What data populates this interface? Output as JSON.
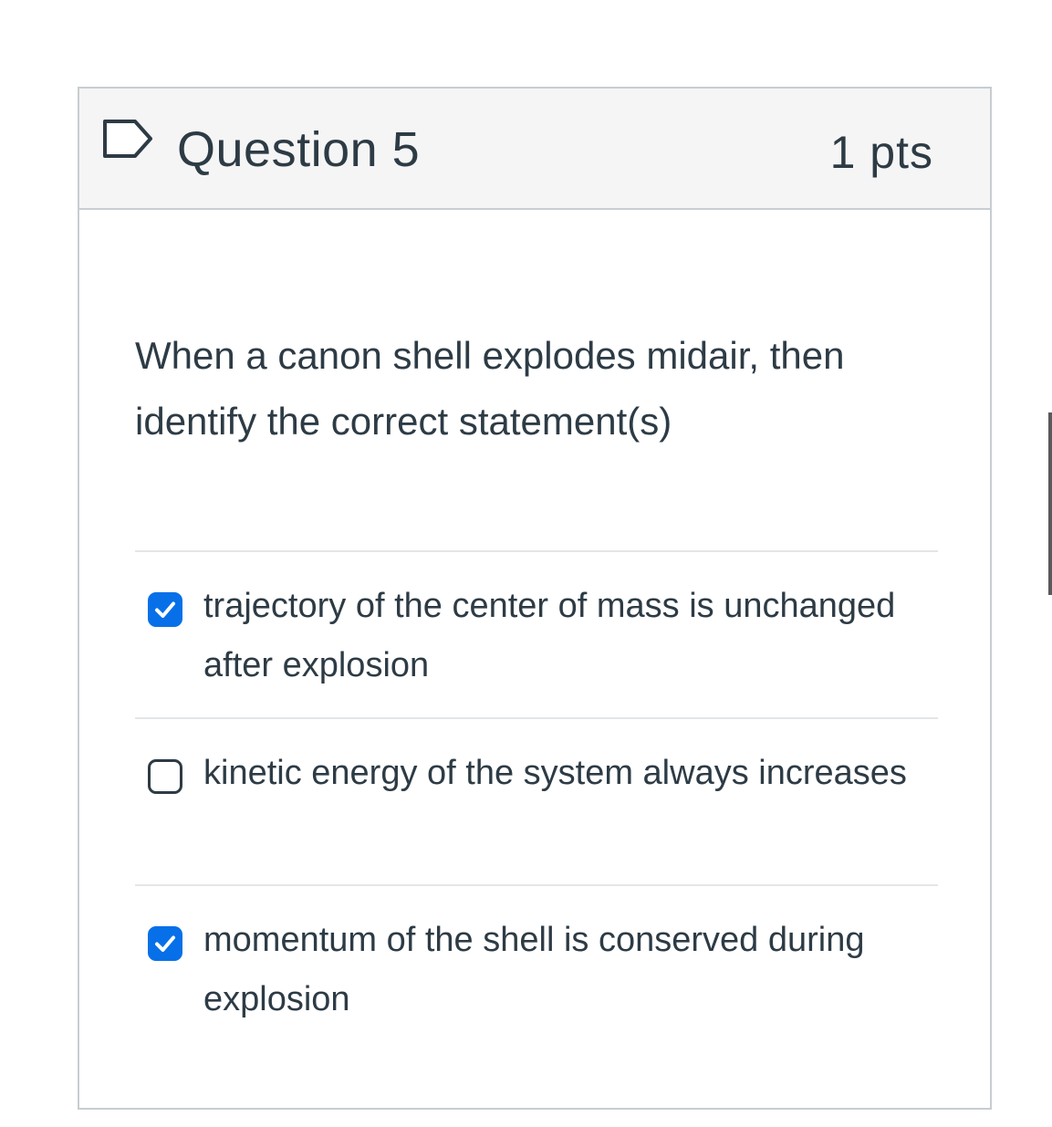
{
  "question": {
    "title": "Question 5",
    "points": "1 pts",
    "text": "When a canon shell explodes midair, then identify the correct statement(s)",
    "flag_icon": "flag-outline-icon",
    "answers": [
      {
        "label": "trajectory of the center of mass is unchanged after explosion",
        "checked": true
      },
      {
        "label": "kinetic energy of the system always increases",
        "checked": false
      },
      {
        "label": "momentum of the shell is conserved during explosion",
        "checked": true
      }
    ]
  },
  "colors": {
    "accent": "#0770e8",
    "text": "#2d3b45",
    "header_bg": "#f5f5f5",
    "border": "#c7cdd1"
  }
}
